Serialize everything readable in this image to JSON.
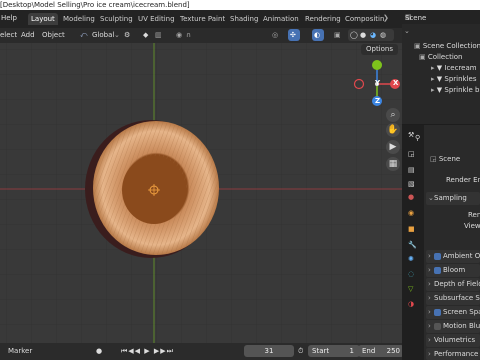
{
  "titlebar": {
    "path": "[Desktop\\Model Selling\\Pro ice cream\\icecream.blend]"
  },
  "menu": {
    "help": "Help",
    "select": "elect",
    "add": "Add",
    "object": "Object"
  },
  "tabs": [
    {
      "label": "Layout",
      "active": true
    },
    {
      "label": "Modeling"
    },
    {
      "label": "Sculpting"
    },
    {
      "label": "UV Editing"
    },
    {
      "label": "Texture Paint"
    },
    {
      "label": "Shading"
    },
    {
      "label": "Animation"
    },
    {
      "label": "Rendering"
    },
    {
      "label": "Compositin"
    }
  ],
  "viewport_header": {
    "orientation": "Global",
    "options": "Options"
  },
  "gizmo": {
    "x": "X",
    "y": "Y",
    "z": "Z"
  },
  "timeline": {
    "marker": "Marker",
    "current_frame": "31",
    "start_label": "Start",
    "start": "1",
    "end_label": "End",
    "end": "250"
  },
  "outliner": {
    "scene_label": "Scene",
    "rows": [
      {
        "label": "Scene Collection"
      },
      {
        "label": "Collection"
      },
      {
        "label": "Icecream"
      },
      {
        "label": "Sprinkles"
      },
      {
        "label": "Sprinkle b"
      }
    ]
  },
  "properties": {
    "scene": "Scene",
    "render_engine": "Render Eng",
    "sampling": "Sampling",
    "render": "Ren",
    "viewport": "View",
    "ambient_occlusion": "Ambient Oc",
    "bloom": "Bloom",
    "depth_of_field": "Depth of Field",
    "subsurface": "Subsurface Sc",
    "screen_space": "Screen Spa",
    "motion_blur": "Motion Blur",
    "volumetrics": "Volumetrics",
    "performance": "Performance"
  },
  "colors": {
    "accent": "#4772b3",
    "x_axis": "#e0484d",
    "y_axis": "#7ec31c",
    "z_axis": "#3c86e3",
    "icecream": "#c98a5a"
  }
}
